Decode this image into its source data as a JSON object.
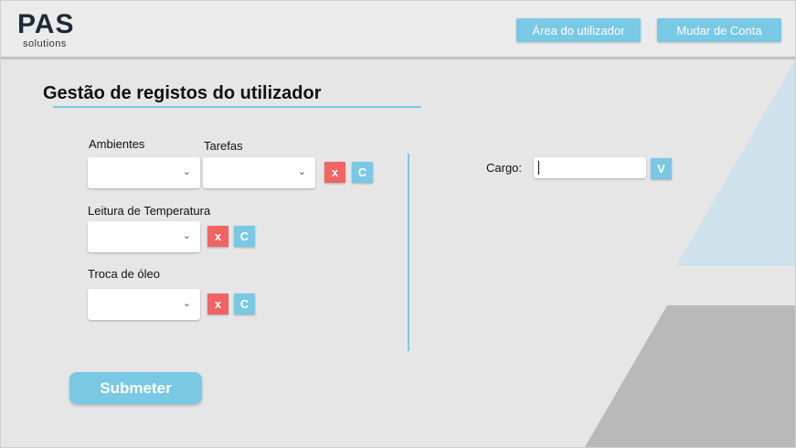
{
  "header": {
    "logo_main": "PAS",
    "logo_sub": "solutions",
    "user_area_label": "Área do utilizador",
    "switch_account_label": "Mudar de Conta"
  },
  "page": {
    "title": "Gestão de registos do utilizador"
  },
  "form": {
    "ambientes_label": "Ambientes",
    "tarefas_label": "Tarefas",
    "leitura_label": "Leitura de Temperatura",
    "troca_label": "Troca de óleo",
    "remove_label": "x",
    "confirm_label": "C",
    "chevron": "⌄",
    "submit_label": "Submeter"
  },
  "cargo": {
    "label": "Cargo:",
    "value": "",
    "confirm_label": "V"
  },
  "colors": {
    "accent": "#79c8e4",
    "danger": "#f06464",
    "background": "#e6e6e6",
    "deco_blue": "#cfe1ea",
    "deco_gray": "#b9b9b9"
  }
}
